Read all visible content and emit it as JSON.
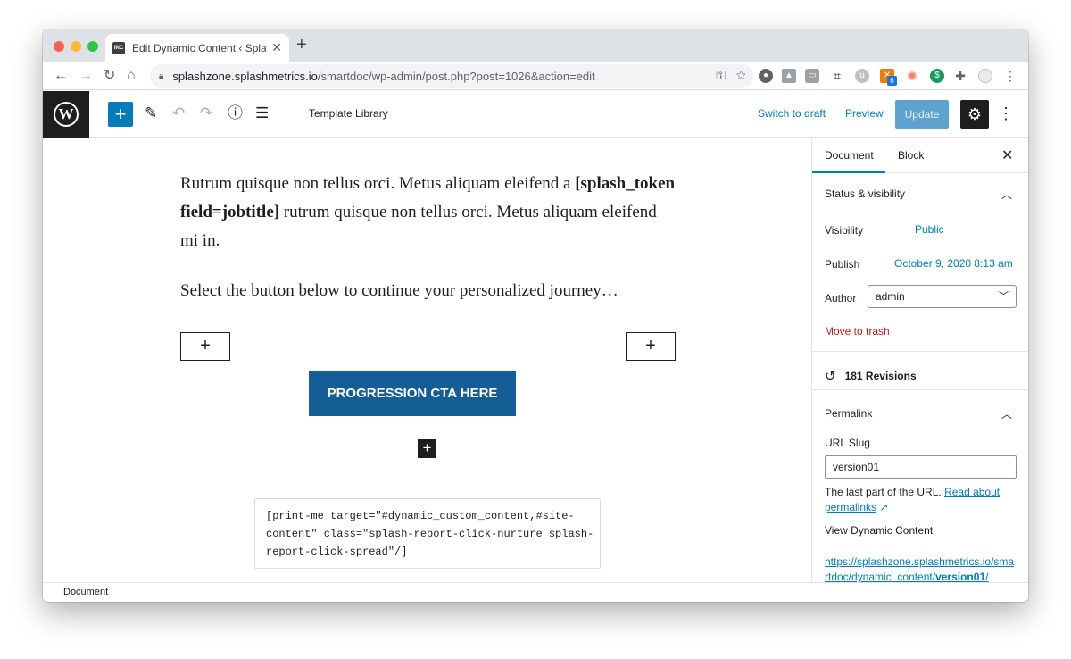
{
  "browser": {
    "tab_title": "Edit Dynamic Content ‹ Splash",
    "favicon_text": "INC",
    "url_host": "splashzone.splashmetrics.io",
    "url_path": "/smartdoc/wp-admin/post.php?post=1026&action=edit",
    "extension_badge": "6"
  },
  "wp_toolbar": {
    "template_library": "Template Library",
    "switch_to_draft": "Switch to draft",
    "preview": "Preview",
    "update": "Update"
  },
  "editor": {
    "paragraph1_a": "Rutrum quisque non tellus orci. Metus aliquam eleifend a ",
    "paragraph1_token": "[splash_token field=jobtitle]",
    "paragraph1_b": " rutrum quisque non tellus orci. Metus aliquam eleifend mi in.",
    "paragraph2": "Select the button below to continue your personalized journey…",
    "cta_label": "PROGRESSION CTA HERE",
    "shortcode": "[print-me target=\"#dynamic_custom_content,#site-\ncontent\" class=\"splash-report-click-nurture splash-\nreport-click-spread\"/]"
  },
  "sidebar": {
    "tabs": [
      "Document",
      "Block"
    ],
    "status_visibility": {
      "heading": "Status & visibility",
      "visibility_label": "Visibility",
      "visibility_value": "Public",
      "publish_label": "Publish",
      "publish_value": "October 9, 2020 8:13 am",
      "author_label": "Author",
      "author_value": "admin",
      "trash": "Move to trash"
    },
    "revisions": "181 Revisions",
    "permalink": {
      "heading": "Permalink",
      "slug_label": "URL Slug",
      "slug_value": "version01",
      "help_text": "The last part of the URL. ",
      "help_link": "Read about permalinks",
      "view_label": "View Dynamic Content",
      "link_text": "https://splashzone.splashmetrics.io/smartdoc/dynamic_content/",
      "link_slug": "version01",
      "link_end": "/"
    }
  },
  "footer": {
    "breadcrumb": "Document"
  }
}
